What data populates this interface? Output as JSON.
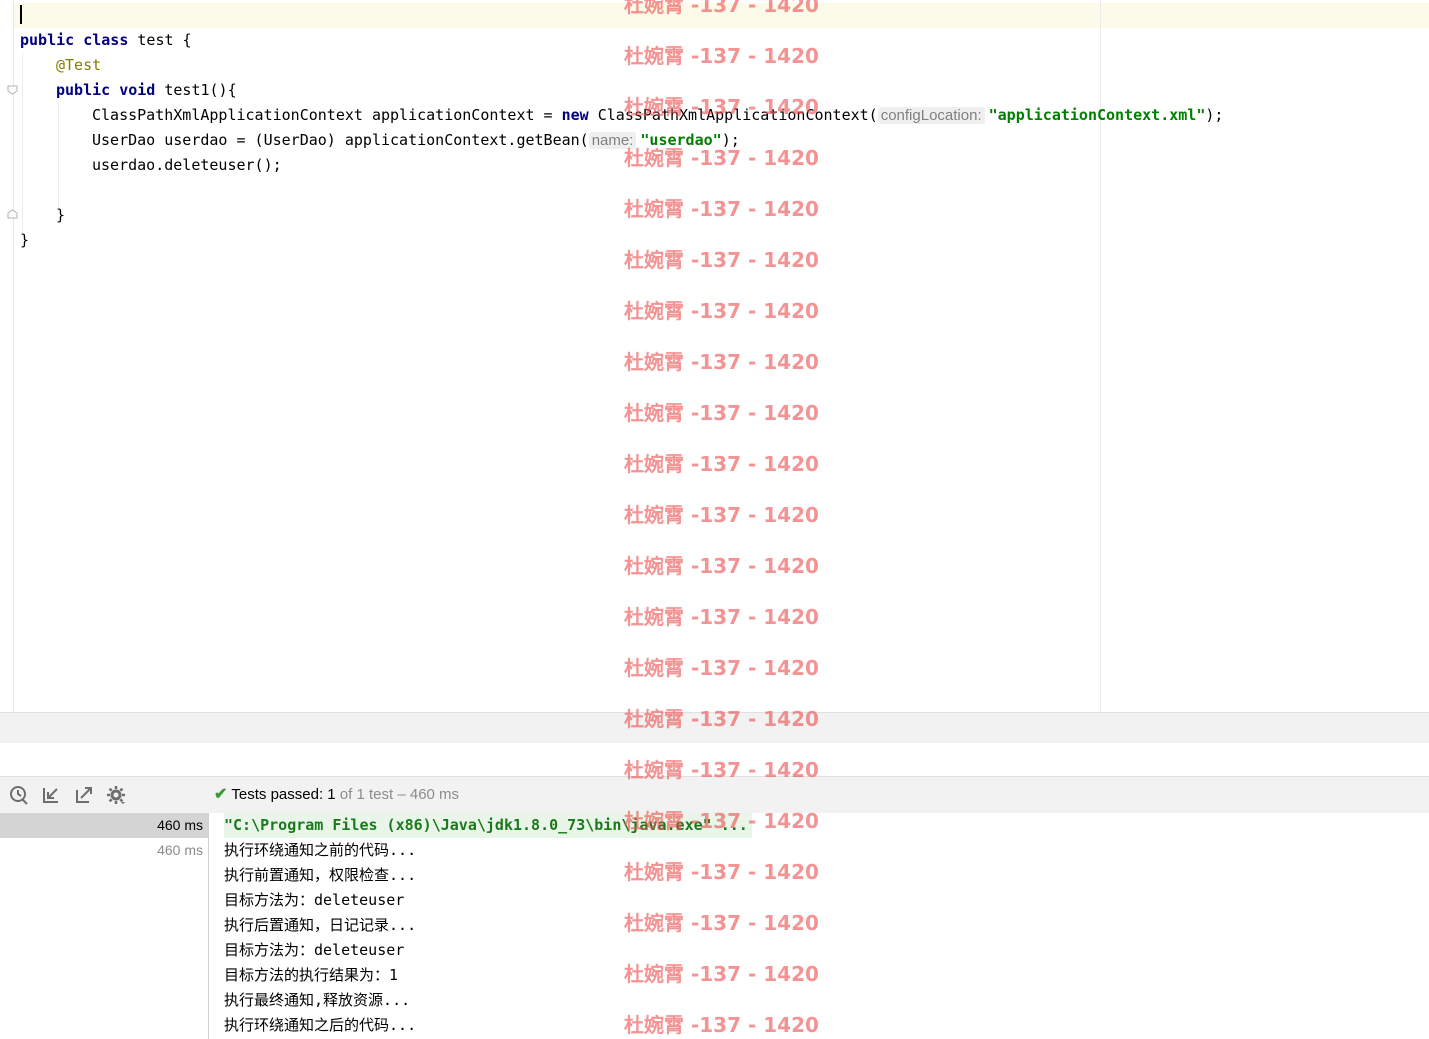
{
  "editor": {
    "lines": [
      {
        "segments": []
      },
      {
        "segments": [
          {
            "t": "public ",
            "c": "kw"
          },
          {
            "t": "class ",
            "c": "kw"
          },
          {
            "t": "test {",
            "c": ""
          }
        ]
      },
      {
        "indent": 36,
        "segments": [
          {
            "t": "@Test",
            "c": "ann"
          }
        ]
      },
      {
        "indent": 36,
        "segments": [
          {
            "t": "public ",
            "c": "kw"
          },
          {
            "t": "void ",
            "c": "kw"
          },
          {
            "t": "test1(){",
            "c": ""
          }
        ]
      },
      {
        "indent": 72,
        "segments": [
          {
            "t": "ClassPathXmlApplicationContext applicationContext = ",
            "c": ""
          },
          {
            "t": "new ",
            "c": "kw"
          },
          {
            "t": "ClassPathXmlApplicationContext(",
            "c": ""
          },
          {
            "t": "configLocation:",
            "c": "hint"
          },
          {
            "t": "\"applicationContext.xml\"",
            "c": "str"
          },
          {
            "t": ");",
            "c": ""
          }
        ]
      },
      {
        "indent": 72,
        "segments": [
          {
            "t": "UserDao userdao = (UserDao) applicationContext.getBean(",
            "c": ""
          },
          {
            "t": "name:",
            "c": "hint"
          },
          {
            "t": "\"userdao\"",
            "c": "str"
          },
          {
            "t": ");",
            "c": ""
          }
        ]
      },
      {
        "indent": 72,
        "segments": [
          {
            "t": "userdao.deleteuser();",
            "c": ""
          }
        ]
      },
      {
        "segments": []
      },
      {
        "indent": 36,
        "segments": [
          {
            "t": "}",
            "c": ""
          }
        ]
      },
      {
        "segments": [
          {
            "t": "}",
            "c": ""
          }
        ]
      }
    ]
  },
  "run_panel": {
    "status_check": "✔",
    "status_main": "Tests passed: ",
    "status_count": "1",
    "status_rest": " of 1 test – 460 ms",
    "toolbar_icons": [
      "history-icon",
      "import-tests-icon",
      "export-tests-icon",
      "settings-icon"
    ],
    "tree": [
      {
        "label": "460 ms",
        "selected": true
      },
      {
        "label": "460 ms",
        "selected": false
      }
    ],
    "console": [
      "\"C:\\Program Files (x86)\\Java\\jdk1.8.0_73\\bin\\java.exe\" ...",
      "执行环绕通知之前的代码...",
      "执行前置通知，权限检查...",
      "目标方法为：deleteuser",
      "执行后置通知，日记记录...",
      "目标方法为：deleteuser",
      "目标方法的执行结果为：1",
      "执行最终通知,释放资源...",
      "执行环绕通知之后的代码..."
    ]
  },
  "watermark": {
    "text": "杜婉霄 -137 - 1420",
    "count": 21,
    "color": "#ee5050"
  }
}
